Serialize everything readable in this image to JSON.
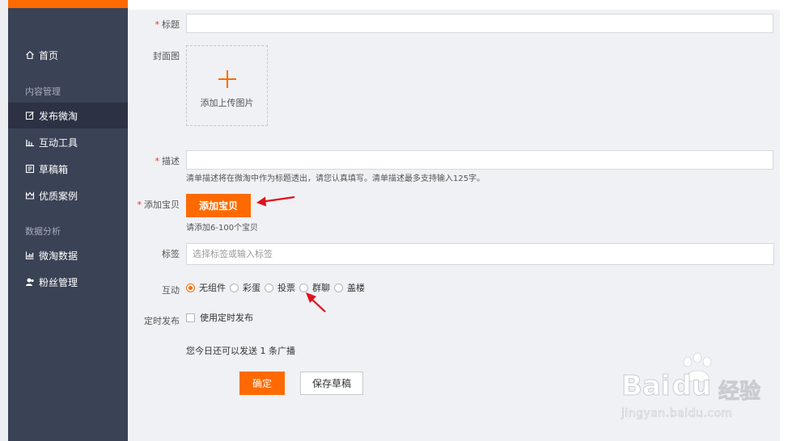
{
  "sidebar": {
    "items": [
      {
        "label": "首页",
        "icon": "home-icon"
      },
      {
        "label": "发布微淘",
        "icon": "edit-icon",
        "active": true
      },
      {
        "label": "互动工具",
        "icon": "bar-chart-icon"
      },
      {
        "label": "草稿箱",
        "icon": "draft-icon"
      },
      {
        "label": "优质案例",
        "icon": "crown-icon"
      },
      {
        "label": "微淘数据",
        "icon": "data-chart-icon"
      },
      {
        "label": "粉丝管理",
        "icon": "fans-icon"
      }
    ],
    "groups": [
      "内容管理",
      "数据分析"
    ]
  },
  "form": {
    "title_label": "标题",
    "cover_label": "封面图",
    "cover_upload_text": "添加上传图片",
    "desc_label": "描述",
    "desc_hint": "清单描述将在微淘中作为标题透出，请您认真填写。清单描述最多支持输入125字。",
    "item_label": "添加宝贝",
    "item_button": "添加宝贝",
    "item_hint": "请添加6-100个宝贝",
    "tag_label": "标签",
    "tag_placeholder": "选择标签或输入标签",
    "interact_label": "互动",
    "interact_options": [
      "无组件",
      "彩蛋",
      "投票",
      "群聊",
      "盖楼"
    ],
    "interact_selected": "无组件",
    "schedule_label": "定时发布",
    "schedule_option": "使用定时发布",
    "broadcast_note": "您今日还可以发送 1 条广播",
    "confirm_button": "确定",
    "save_draft_button": "保存草稿"
  },
  "watermark": {
    "brand": "Bai",
    "brand_du": "du",
    "brand_cn": "经验",
    "url": "jingyan.baidu.com"
  },
  "colors": {
    "accent": "#ff6a00",
    "sidebar_bg": "#3a4255",
    "sidebar_active": "#2c3243",
    "required": "#e62e2e",
    "annotation_arrow": "#e0111b"
  }
}
